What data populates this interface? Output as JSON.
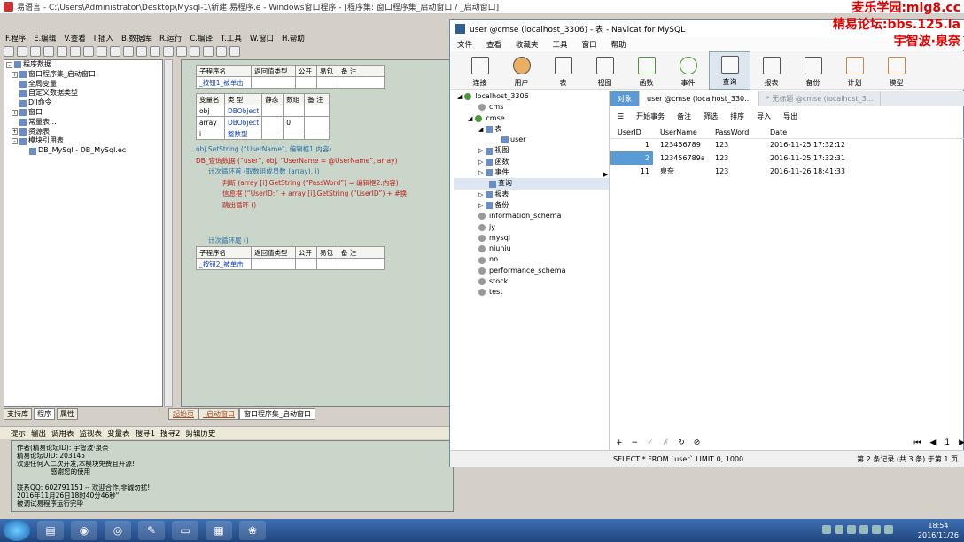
{
  "yy": {
    "title": "易语言 - C:\\Users\\Administrator\\Desktop\\Mysql-1\\新建 易程序.e - Windows窗口程序 - [程序集: 窗口程序集_启动窗口 / _启动窗口]",
    "menu": [
      "F.程序",
      "E.编辑",
      "V.查看",
      "I.插入",
      "B.数据库",
      "R.运行",
      "C.编译",
      "T.工具",
      "W.窗口",
      "H.帮助"
    ],
    "tree": [
      {
        "label": "程序数据",
        "kind": "root"
      },
      {
        "label": "窗口程序集_启动窗口",
        "kind": "node"
      },
      {
        "label": "全局变量",
        "kind": "leaf"
      },
      {
        "label": "自定义数据类型",
        "kind": "leaf"
      },
      {
        "label": "Dll命令",
        "kind": "leaf"
      },
      {
        "label": "窗口",
        "kind": "node"
      },
      {
        "label": "常量表...",
        "kind": "leaf"
      },
      {
        "label": "资源表",
        "kind": "node"
      },
      {
        "label": "模块引用表",
        "kind": "node"
      },
      {
        "label": "DB_MySql - DB_MySql.ec",
        "kind": "sub"
      }
    ],
    "left_tabs": [
      "支持库",
      "程序",
      "属性"
    ],
    "sub_header": [
      "子程序名",
      "返回值类型",
      "公开",
      "易包",
      "备 注"
    ],
    "sub1_name": "_按钮1_被单击",
    "var_header": [
      "变量名",
      "类 型",
      "静态",
      "数组",
      "备 注"
    ],
    "vars": [
      {
        "name": "obj",
        "type": "DBObject",
        "static": "",
        "array": ""
      },
      {
        "name": "array",
        "type": "DBObject",
        "static": "",
        "array": "0"
      },
      {
        "name": "i",
        "type": "整数型",
        "static": "",
        "array": ""
      }
    ],
    "code": [
      "obj.SetString (“UserName”, 编辑框1.内容)",
      "DB_查询数据 (“user”, obj, “UserName = @UserName”, array)",
      "计次循环首 (取数组成员数 (array), i)",
      "判断 (array [i].GetString (“PassWord”) = 编辑框2.内容)",
      "信息框 (“UserID:” + array [i].GetString (“UserID”) + #换",
      "跳出循环 ()",
      "计次循环尾 ()"
    ],
    "sub2_name": "_按钮2_被单击",
    "editor_tabs": [
      "起始页",
      "_启动窗口",
      "窗口程序集_启动窗口"
    ],
    "bottom_tabs": [
      "提示",
      "输出",
      "调用表",
      "监视表",
      "变量表",
      "搜寻1",
      "搜寻2",
      "剪辑历史"
    ],
    "output": "作者(精易论坛ID): 宇智波·泉奈\n精易论坛UID: 203145\n欢迎任何人二次开发,本模块免费且开源!\n                感谢您的使用\n\n联系QQ: 602791151 -- 欢迎合作,非诚勿扰!\n2016年11月26日18时40分46秒\"\n被调试易程序运行完毕"
  },
  "navicat": {
    "title": "user @cmse (localhost_3306) - 表 - Navicat for MySQL",
    "menu": [
      "文件",
      "查看",
      "收藏夹",
      "工具",
      "窗口",
      "帮助"
    ],
    "tools": [
      "连接",
      "用户",
      "表",
      "视图",
      "函数",
      "事件",
      "查询",
      "报表",
      "备份",
      "计划",
      "模型"
    ],
    "active_tool": "查询",
    "tree": [
      {
        "label": "localhost_3306",
        "kind": "conn"
      },
      {
        "label": "cms",
        "kind": "db"
      },
      {
        "label": "cmse",
        "kind": "dbopen"
      },
      {
        "label": "表",
        "kind": "group"
      },
      {
        "label": "user",
        "kind": "table"
      },
      {
        "label": "视图",
        "kind": "group"
      },
      {
        "label": "函数",
        "kind": "group"
      },
      {
        "label": "事件",
        "kind": "group"
      },
      {
        "label": "查询",
        "kind": "groupsel"
      },
      {
        "label": "报表",
        "kind": "group"
      },
      {
        "label": "备份",
        "kind": "group"
      },
      {
        "label": "information_schema",
        "kind": "db"
      },
      {
        "label": "jy",
        "kind": "db"
      },
      {
        "label": "mysql",
        "kind": "db"
      },
      {
        "label": "niuniu",
        "kind": "db"
      },
      {
        "label": "nn",
        "kind": "db"
      },
      {
        "label": "performance_schema",
        "kind": "db"
      },
      {
        "label": "stock",
        "kind": "db"
      },
      {
        "label": "test",
        "kind": "db"
      }
    ],
    "tabs": [
      "对象",
      "user @cmse (localhost_330...",
      "* 无标题 @cmse (localhost_3..."
    ],
    "subtoolbar": [
      "开始事务",
      "备注",
      "筛选",
      "排序",
      "导入",
      "导出"
    ],
    "columns": [
      "UserID",
      "UserName",
      "PassWord",
      "Date"
    ],
    "rows": [
      {
        "UserID": "1",
        "UserName": "123456789",
        "PassWord": "123",
        "Date": "2016-11-25 17:32:12"
      },
      {
        "UserID": "2",
        "UserName": "123456789a",
        "PassWord": "123",
        "Date": "2016-11-25 17:32:31"
      },
      {
        "UserID": "11",
        "UserName": "泉奈",
        "PassWord": "123",
        "Date": "2016-11-26 18:41:33"
      }
    ],
    "sql": "SELECT * FROM `user` LIMIT 0, 1000",
    "record_status": "第 2 条记录 (共 3 条) 于第 1 页",
    "page": "1"
  },
  "watermark": [
    "麦乐学园:mlg8.cc",
    "精易论坛:bbs.125.la",
    "宇智波·泉奈"
  ],
  "taskbar": {
    "time": "18:54",
    "date": "2016/11/26"
  }
}
